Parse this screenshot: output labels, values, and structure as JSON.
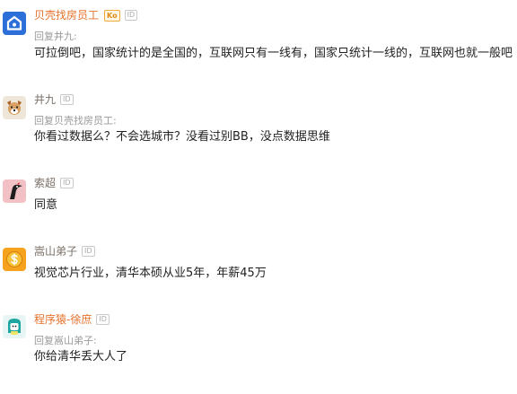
{
  "comments": [
    {
      "username": "贝壳找房员工",
      "level_badge": "Ko",
      "id_badge": "ID",
      "reply_to": "回复井九:",
      "text": "可拉倒吧，国家统计的是全国的，互联网只有一线有，国家只统计一线的，互联网也就一般吧",
      "avatar_icon": "house-logo-icon",
      "name_color": "#e5702a"
    },
    {
      "username": "井九",
      "id_badge": "ID",
      "reply_to": "回复贝壳找房员工:",
      "text": "你看过数据么？不会选城市？没看过别BB，没点数据思维",
      "avatar_icon": "dog-face-icon"
    },
    {
      "username": "索超",
      "id_badge": "ID",
      "text": "同意",
      "avatar_icon": "woodpecker-icon"
    },
    {
      "username": "嵩山弟子",
      "id_badge": "ID",
      "text": "视觉芯片行业，清华本硕从业5年，年薪45万",
      "avatar_icon": "dollar-coin-icon"
    },
    {
      "username": "程序猿-徐庶",
      "id_badge": "ID",
      "reply_to": "回复嵩山弟子:",
      "text": "你给清华丢大人了",
      "avatar_icon": "programmer-icon",
      "name_color": "#e5702a"
    }
  ]
}
